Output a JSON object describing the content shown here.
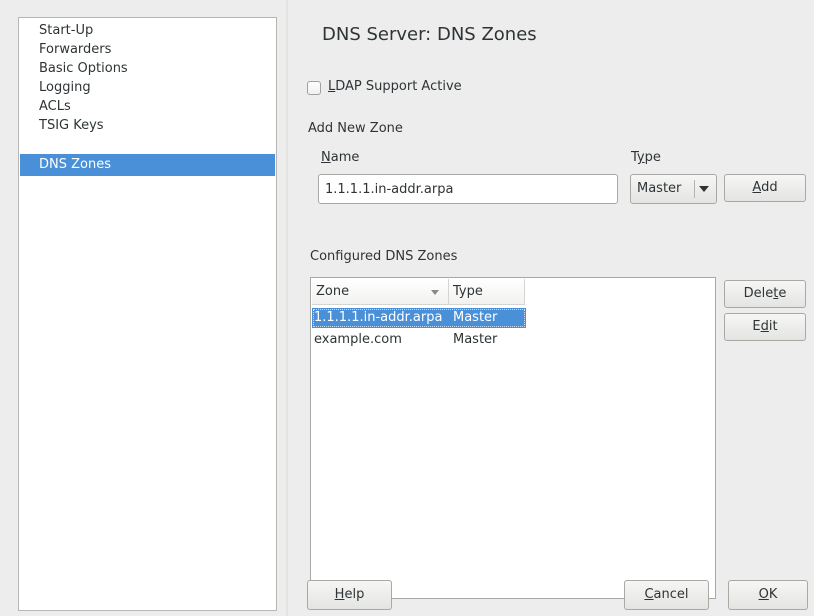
{
  "sidebar": {
    "items": [
      {
        "label": "Start-Up"
      },
      {
        "label": "Forwarders"
      },
      {
        "label": "Basic Options"
      },
      {
        "label": "Logging"
      },
      {
        "label": "ACLs"
      },
      {
        "label": "TSIG Keys"
      },
      {
        "label": "DNS Zones",
        "selected": true
      }
    ]
  },
  "main": {
    "title": "DNS Server: DNS Zones",
    "ldap_checkbox": {
      "mnemonic": "L",
      "label_rest": "DAP Support Active",
      "checked": false
    },
    "add_zone": {
      "section_label": "Add New Zone",
      "name_label_mnemonic": "N",
      "name_label_rest": "ame",
      "name_value": "1.1.1.1.in-addr.arpa",
      "type_label_pre": "T",
      "type_label_mnemonic": "y",
      "type_label_rest": "pe",
      "type_value": "Master",
      "add_button_mnemonic": "A",
      "add_button_rest": "dd"
    },
    "configured": {
      "section_label": "Configured DNS Zones",
      "columns": [
        "Zone",
        "Type"
      ],
      "rows": [
        {
          "zone": "1.1.1.1.in-addr.arpa",
          "type": "Master",
          "selected": true
        },
        {
          "zone": "example.com",
          "type": "Master"
        }
      ],
      "delete_button_pre": "Dele",
      "delete_button_mnemonic": "t",
      "delete_button_rest": "e",
      "edit_button_pre": "E",
      "edit_button_mnemonic": "d",
      "edit_button_rest": "it"
    }
  },
  "footer": {
    "help_mnemonic": "H",
    "help_rest": "elp",
    "cancel_mnemonic": "C",
    "cancel_rest": "ancel",
    "ok_mnemonic": "O",
    "ok_rest": "K"
  },
  "colors": {
    "selection": "#4a90d9",
    "background": "#ededed"
  }
}
